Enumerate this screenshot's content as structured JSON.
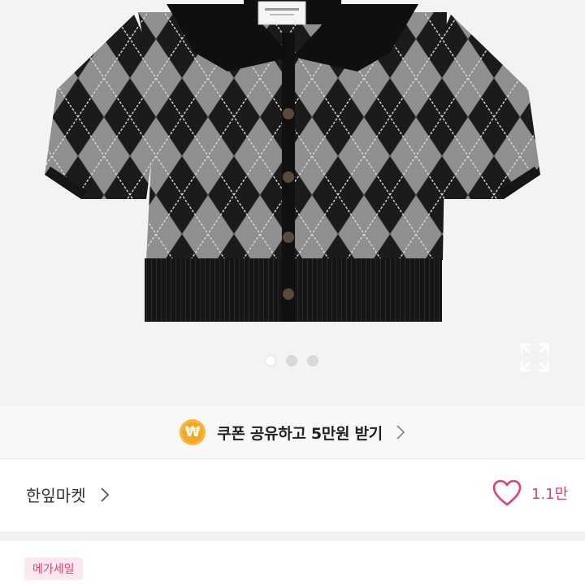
{
  "product": {
    "image_name": "argyle knit cardigan",
    "carousel": {
      "total": 3,
      "active": 1
    }
  },
  "coupon": {
    "icon": "won-coin-icon",
    "icon_text": "₩",
    "label": "쿠폰 공유하고 5만원 받기"
  },
  "shop": {
    "name": "한잎마켓",
    "like_count": "1.1만",
    "like_icon": "heart-outline-icon"
  },
  "badge": {
    "label": "메가세일"
  },
  "colors": {
    "accent_pink": "#e0407a",
    "coin": "#f5a623"
  }
}
